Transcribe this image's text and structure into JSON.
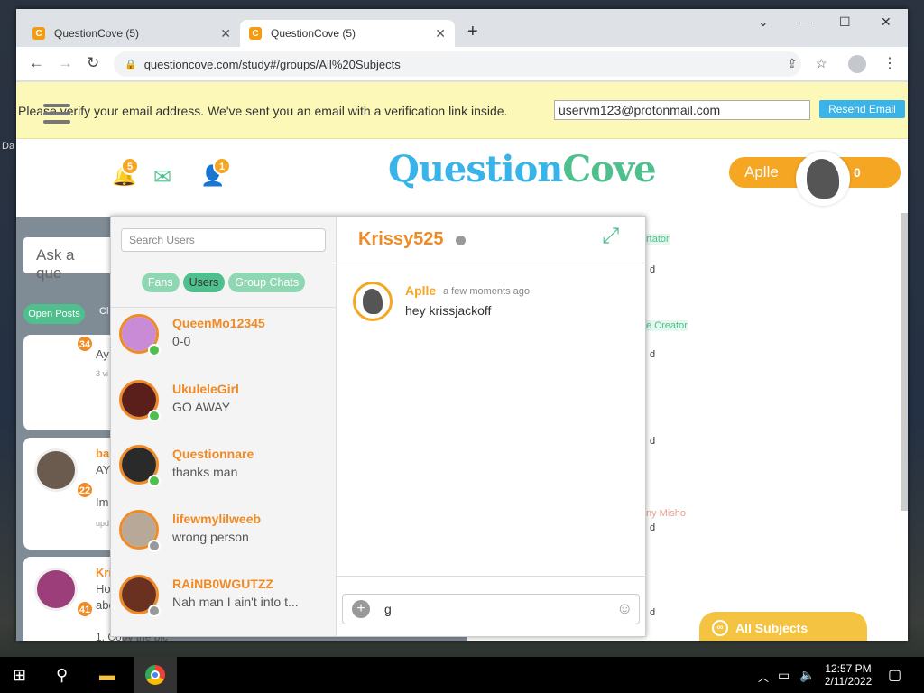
{
  "desktop": {
    "labels": [
      "Da"
    ]
  },
  "browser": {
    "tabs": [
      {
        "title": "QuestionCove (5)"
      },
      {
        "title": "QuestionCove (5)"
      }
    ],
    "url": "questioncove.com/study#/groups/All%20Subjects"
  },
  "verify": {
    "message": "Please verify your email address. We've sent you an email with a verification link inside.",
    "email": "uservm123@protonmail.com",
    "resend_label": "Resend Email"
  },
  "header": {
    "notif_count": "5",
    "friends_count": "1",
    "logo_a": "Question",
    "logo_b": "Cove",
    "username": "Aplle",
    "score": "0"
  },
  "feed": {
    "ask_placeholder": "Ask a que",
    "open_posts_label": "Open Posts",
    "tab2_label": "Cl",
    "cards": [
      {
        "badge": "34",
        "line1": "Ay",
        "line2": "3 vi"
      },
      {
        "badge": "22",
        "name": "ba",
        "line1": "AY",
        "line2": "Im",
        "line3": "upd"
      },
      {
        "badge": "41",
        "name": "Kri",
        "line1": "Ho",
        "line2": "abo",
        "line3": "1. Copy the pic"
      }
    ]
  },
  "right_peek": {
    "tags": [
      "rtator",
      "e Creator",
      "ny Misho"
    ],
    "letters": [
      "d",
      "d",
      "d",
      "d",
      "d"
    ]
  },
  "chat": {
    "search_placeholder": "Search Users",
    "filters": [
      "Fans",
      "Users",
      "Group Chats"
    ],
    "users": [
      {
        "name": "QueenMo12345",
        "message": "0-0",
        "online": true
      },
      {
        "name": "UkuleleGirl",
        "message": "GO AWAY",
        "online": true
      },
      {
        "name": "Questionnare",
        "message": "thanks man",
        "online": true
      },
      {
        "name": "lifewmylilweeb",
        "message": "wrong person",
        "online": false
      },
      {
        "name": "RAiNB0WGUTZZ",
        "message": "Nah man I ain't into t...",
        "online": false
      }
    ],
    "active_user": "Krissy525",
    "messages": [
      {
        "sender": "Aplle",
        "time": "a few moments ago",
        "text": "hey krissjackoff"
      }
    ],
    "input_value": "g"
  },
  "subjects_label": "All Subjects",
  "clock": {
    "time": "12:57 PM",
    "date": "2/11/2022"
  }
}
